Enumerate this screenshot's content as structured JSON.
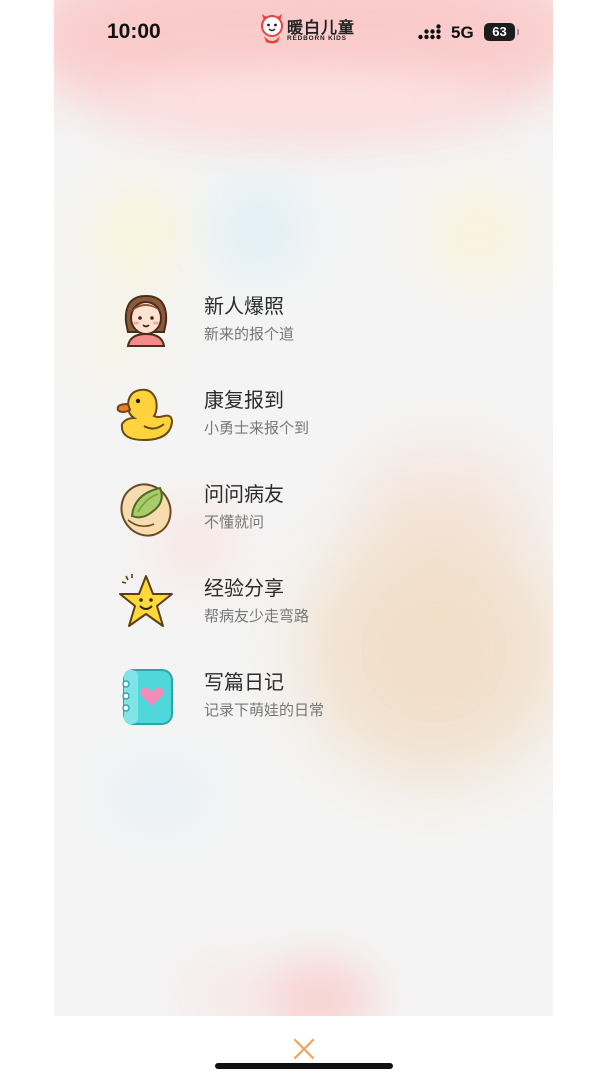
{
  "status_bar": {
    "time": "10:00",
    "network": "5G",
    "battery": "63",
    "signal_icon": "signal-bars-icon"
  },
  "brand": {
    "name_cn": "暖白儿童",
    "name_en": "REDBORN KIDS",
    "accent_color": "#e8423f"
  },
  "menu": {
    "items": [
      {
        "title": "新人爆照",
        "subtitle": "新来的报个道",
        "icon": "girl-avatar-icon"
      },
      {
        "title": "康复报到",
        "subtitle": "小勇士来报个到",
        "icon": "duck-icon"
      },
      {
        "title": "问问病友",
        "subtitle": "不懂就问",
        "icon": "pistachio-icon"
      },
      {
        "title": "经验分享",
        "subtitle": "帮病友少走弯路",
        "icon": "star-icon"
      },
      {
        "title": "写篇日记",
        "subtitle": "记录下萌娃的日常",
        "icon": "heart-notebook-icon"
      }
    ]
  },
  "close_button": {
    "icon": "close-icon",
    "color": "#f0a35a"
  }
}
